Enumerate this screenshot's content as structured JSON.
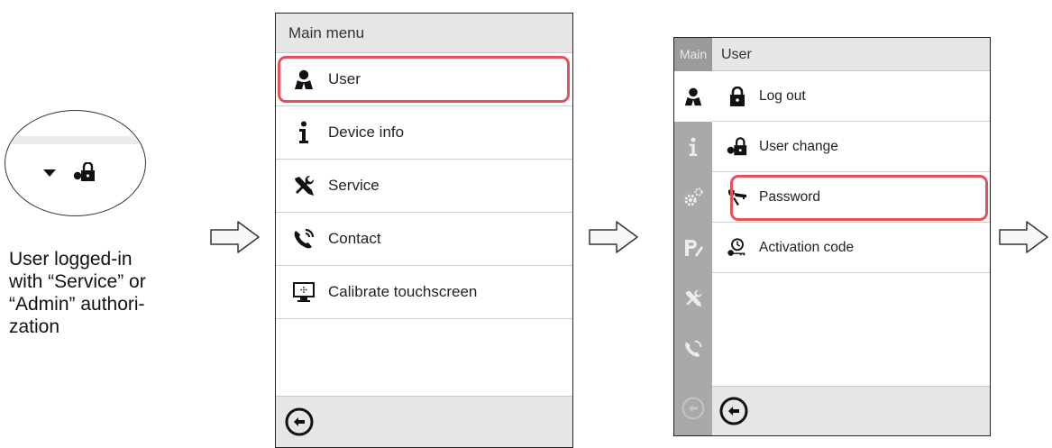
{
  "caption": {
    "line1": "User logged-in",
    "line2": "with “Service” or",
    "line3": "“Admin” authori-",
    "line4": "zation"
  },
  "main_menu": {
    "title": "Main menu",
    "items": [
      {
        "label": "User",
        "icon": "user-icon"
      },
      {
        "label": "Device info",
        "icon": "info-icon"
      },
      {
        "label": "Service",
        "icon": "tools-icon"
      },
      {
        "label": "Contact",
        "icon": "phone-icon"
      },
      {
        "label": "Calibrate touchscreen",
        "icon": "touchscreen-icon"
      }
    ],
    "highlighted": "User"
  },
  "user_menu": {
    "sidebar_title": "Main",
    "title": "User",
    "items": [
      {
        "label": "Log out",
        "icon": "lock-icon"
      },
      {
        "label": "User change",
        "icon": "user-change-icon"
      },
      {
        "label": "Password",
        "icon": "password-key-icon"
      },
      {
        "label": "Activation code",
        "icon": "activation-key-icon"
      }
    ],
    "highlighted": "Password"
  },
  "colors": {
    "highlight": "#e4515a",
    "header_bg": "#e6e6e6",
    "sidebar_bg": "#a9a9a9"
  }
}
